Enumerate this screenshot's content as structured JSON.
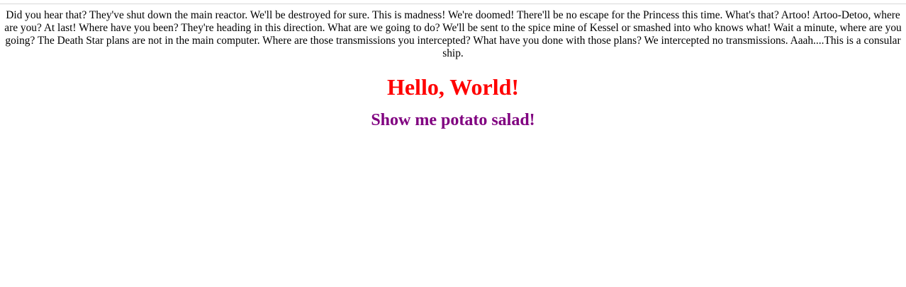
{
  "paragraph": {
    "text": "Did you hear that? They've shut down the main reactor. We'll be destroyed for sure. This is madness! We're doomed! There'll be no escape for the Princess this time. What's that? Artoo! Artoo-Detoo, where are you? At last! Where have you been? They're heading in this direction. What are we going to do? We'll be sent to the spice mine of Kessel or smashed into who knows what! Wait a minute, where are you going? The Death Star plans are not in the main computer. Where are those transmissions you intercepted? What have you done with those plans? We intercepted no transmissions. Aaah....This is a consular ship."
  },
  "heading_main": {
    "text": "Hello, World!",
    "color": "#ff0000"
  },
  "heading_sub": {
    "text": "Show me potato salad!",
    "color": "#800080"
  }
}
